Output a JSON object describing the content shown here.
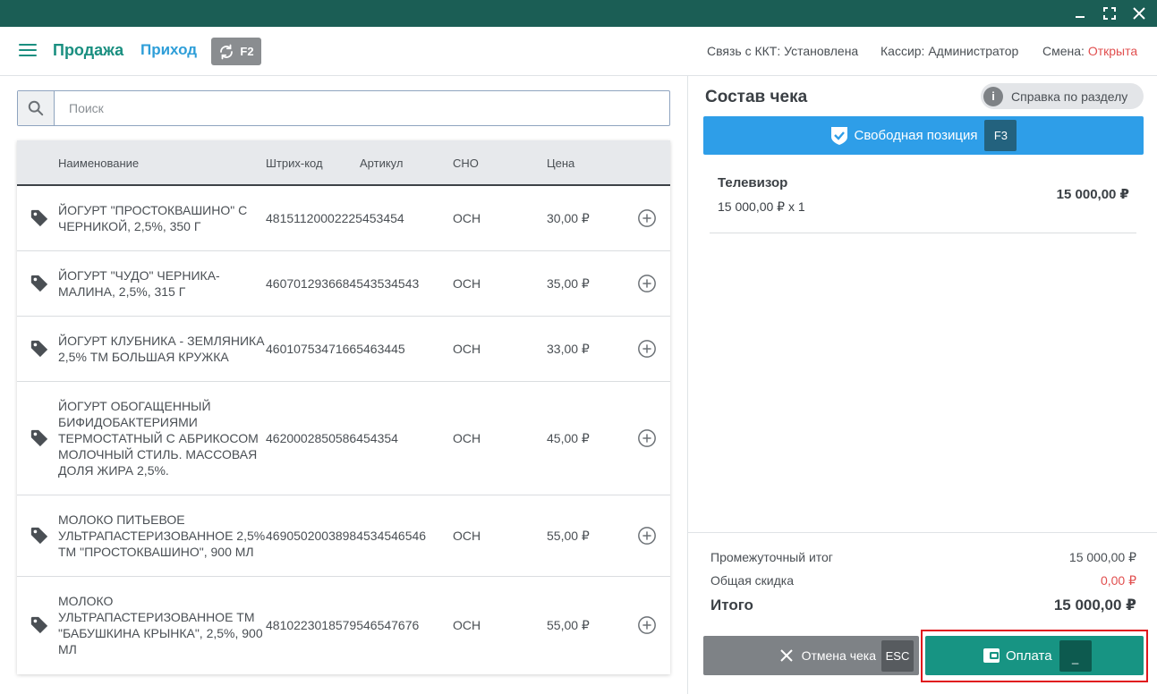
{
  "window": {
    "controls": [
      "minimize-icon",
      "maximize-icon",
      "close-icon"
    ]
  },
  "header": {
    "menu_icon": "hamburger-icon",
    "nav_sale": "Продажа",
    "nav_income": "Приход",
    "switch_key": "F2",
    "kkt_status": "Связь с ККТ: Установлена",
    "cashier": "Кассир: Администратор",
    "shift_label": "Смена:",
    "shift_value": "Открыта"
  },
  "search": {
    "placeholder": "Поиск",
    "value": ""
  },
  "table": {
    "headers": {
      "name": "Наименование",
      "barcode": "Штрих-код",
      "article": "Артикул",
      "tax": "СНО",
      "price": "Цена"
    },
    "rows": [
      {
        "name": "ЙОГУРТ \"ПРОСТОКВАШИНО\" С ЧЕРНИКОЙ, 2,5%, 350 Г",
        "barcode": "4815112000222545345​4",
        "article": "",
        "tax": "ОСН",
        "price": "30,00 ₽"
      },
      {
        "name": "ЙОГУРТ \"ЧУДО\" ЧЕРНИКА-МАЛИНА, 2,5%, 315 Г",
        "barcode": "4607012936684543534543",
        "article": "",
        "tax": "ОСН",
        "price": "35,00 ₽"
      },
      {
        "name": "ЙОГУРТ КЛУБНИКА - ЗЕМЛЯНИКА 2,5% ТМ БОЛЬШАЯ КРУЖКА",
        "barcode": "46010753471665463445",
        "article": "",
        "tax": "ОСН",
        "price": "33,00 ₽"
      },
      {
        "name": "ЙОГУРТ ОБОГАЩЕННЫЙ БИФИДОБАКТЕРИЯМИ ТЕРМОСТАТНЫЙ С АБРИКОСОМ МОЛОЧНЫЙ СТИЛЬ. МАССОВАЯ ДОЛЯ ЖИРА 2,5%.",
        "barcode": "4620002850586454354",
        "article": "",
        "tax": "ОСН",
        "price": "45,00 ₽"
      },
      {
        "name": "МОЛОКО ПИТЬЕВОЕ УЛЬТРАПАСТЕРИЗОВАННОЕ 2,5% ТМ \"ПРОСТОКВАШИНО\", 900 МЛ",
        "barcode": "4690502003898453454654​6",
        "article": "",
        "tax": "ОСН",
        "price": "55,00 ₽"
      },
      {
        "name": "МОЛОКО УЛЬТРАПАСТЕРИЗОВАННОЕ ТМ \"БАБУШКИНА КРЫНКА\", 2,5%, 900 МЛ",
        "barcode": "4810223018579546547676",
        "article": "",
        "tax": "ОСН",
        "price": "55,00 ₽"
      }
    ]
  },
  "receipt": {
    "title": "Состав чека",
    "help_label": "Справка по разделу",
    "help_icon": "info-icon",
    "free_position_label": "Свободная позиция",
    "free_position_key": "F3",
    "free_position_icon": "shield-check-icon",
    "items": [
      {
        "name": "Телевизор",
        "qty_line": "15 000,00 ₽ x 1",
        "sum": "15 000,00 ₽"
      }
    ]
  },
  "totals": {
    "subtotal_label": "Промежуточный итог",
    "subtotal_value": "15 000,00 ₽",
    "discount_label": "Общая скидка",
    "discount_value": "0,00 ₽",
    "total_label": "Итого",
    "total_value": "15 000,00 ₽"
  },
  "actions": {
    "cancel_label": "Отмена чека",
    "cancel_key": "ESC",
    "pay_label": "Оплата",
    "pay_key": "_"
  },
  "colors": {
    "titlebar": "#1b5e55",
    "accent_green": "#1a8f80",
    "accent_blue": "#2e9ed8",
    "pay_button": "#179483",
    "red": "#e14f4f",
    "highlight": "#e0161c"
  }
}
